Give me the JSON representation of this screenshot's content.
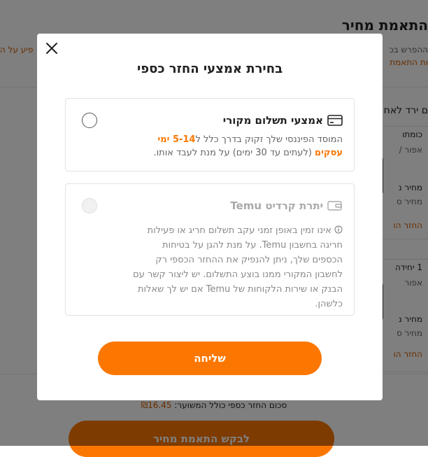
{
  "background": {
    "title": "התאמת מחיר",
    "line1": "ההפרש בכ",
    "line2": "ות התאמת",
    "left_link": "פיע על ה",
    "heading": "ם ירד לאח",
    "card1": {
      "line1": "כומתו",
      "line2": "אפור /",
      "price_label": "מחיר נ",
      "price_label2": "מחיר ס",
      "refund": "החזר הו"
    },
    "card2": {
      "line1": "1 יחידה",
      "line2": "אפור",
      "price_label": "מחיר נ",
      "price_label2": "מחיר ס",
      "refund": "החזר הו"
    },
    "total_label": "סכום החזר כספי כולל המשוער:",
    "total_amount": "₪16.45",
    "request_button": "לבקש התאמת מחיר"
  },
  "modal": {
    "title": "בחירת אמצעי החזר כספי",
    "close_icon": "close-icon",
    "option1": {
      "label": "אמצעי תשלום מקורי",
      "icon": "credit-card-icon",
      "desc_prefix": "המוסד הפיננסי שלך זקוק בדרך כלל ל",
      "desc_highlight": "5-14 ימי עסקים",
      "desc_suffix": " (לעתים עד 30 ימים) על מנת לעבד אותו."
    },
    "option2": {
      "label": "יתרת קרדיט Temu",
      "icon": "wallet-icon",
      "desc": "אינו זמין באופן זמני עקב תשלום חריג או פעילות חריגה בחשבון Temu. על מנת להגן על בטיחות הכספים שלך, ניתן להנפיק את ההחזר הכספי רק לחשבון המקורי ממנו בוצע התשלום. יש ליצור קשר עם הבנק או שירות הלקוחות של Temu אם יש לך שאלות כלשהן."
    },
    "submit_label": "שליחה"
  },
  "colors": {
    "accent": "#fb7701",
    "overlay": "rgba(0,0,0,0.5)"
  }
}
